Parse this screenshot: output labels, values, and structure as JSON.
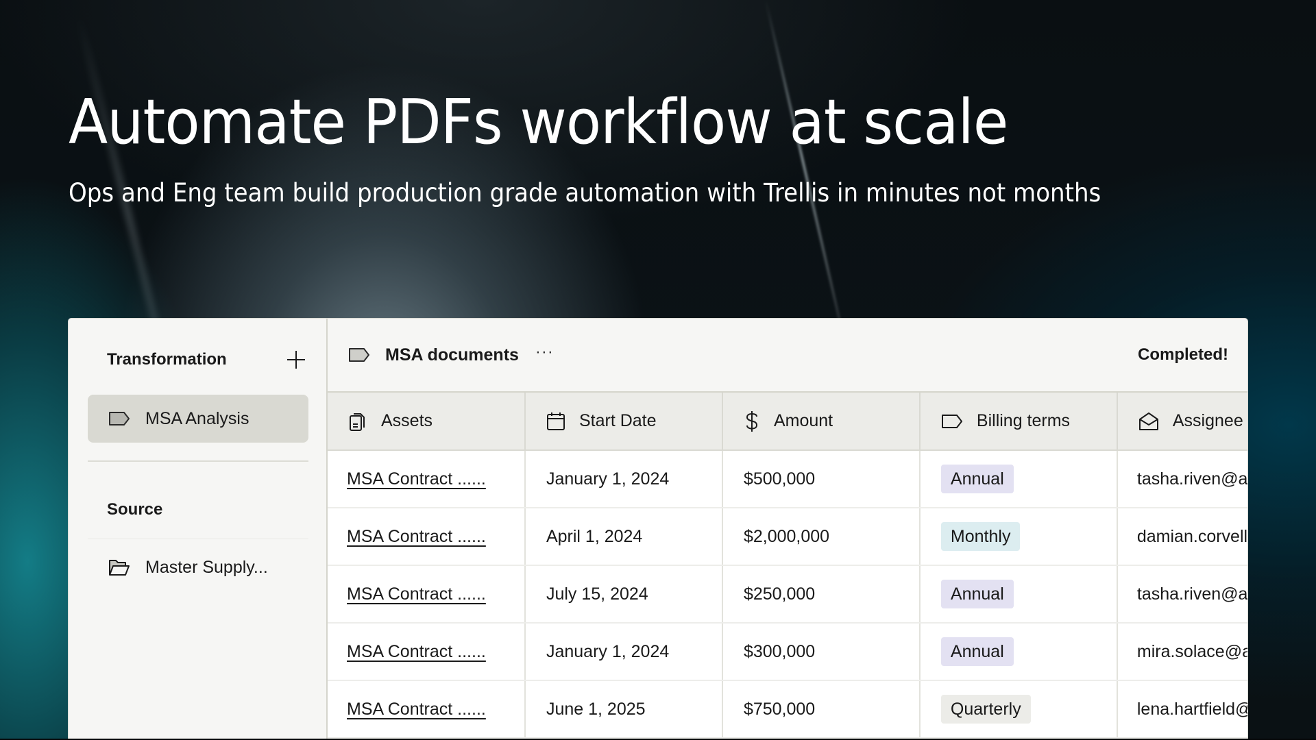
{
  "hero": {
    "title": "Automate PDFs workflow at scale",
    "subtitle": "Ops and Eng team build production grade automation with Trellis in minutes not months"
  },
  "sidebar": {
    "transformation_title": "Transformation",
    "add_icon": "plus-icon",
    "transformations": [
      {
        "label": "MSA Analysis",
        "icon": "tag-icon",
        "active": true
      }
    ],
    "source_title": "Source",
    "sources": [
      {
        "label": "Master Supply...",
        "icon": "folder-open-icon"
      }
    ]
  },
  "toolbar": {
    "icon": "tag-icon",
    "title": "MSA documents",
    "more_label": "···",
    "status": "Completed!"
  },
  "table": {
    "columns": [
      {
        "label": "Assets",
        "icon": "documents-icon"
      },
      {
        "label": "Start Date",
        "icon": "calendar-icon"
      },
      {
        "label": "Amount",
        "icon": "dollar-icon"
      },
      {
        "label": "Billing terms",
        "icon": "tag-icon"
      },
      {
        "label": "Assignee",
        "icon": "envelope-open-icon"
      }
    ],
    "rows": [
      {
        "asset": "MSA Contract ......",
        "start_date": "January 1, 2024",
        "amount": "$500,000",
        "billing": "Annual",
        "billing_type": "annual",
        "assignee": "tasha.riven@ac..."
      },
      {
        "asset": "MSA Contract ......",
        "start_date": "April 1, 2024",
        "amount": "$2,000,000",
        "billing": "Monthly",
        "billing_type": "monthly",
        "assignee": "damian.corvell@..."
      },
      {
        "asset": "MSA Contract ......",
        "start_date": "July 15, 2024",
        "amount": "$250,000",
        "billing": "Annual",
        "billing_type": "annual",
        "assignee": "tasha.riven@ac..."
      },
      {
        "asset": "MSA Contract ......",
        "start_date": "January 1, 2024",
        "amount": "$300,000",
        "billing": "Annual",
        "billing_type": "annual",
        "assignee": "mira.solace@ac..."
      },
      {
        "asset": "MSA Contract ......",
        "start_date": "June 1, 2025",
        "amount": "$750,000",
        "billing": "Quarterly",
        "billing_type": "quarterly",
        "assignee": "lena.hartfield@a..."
      }
    ]
  },
  "colors": {
    "badge_annual": "#e3e1f2",
    "badge_monthly": "#dcedf0",
    "badge_quarterly": "#ecece8",
    "active_item": "#d9d9d2"
  }
}
